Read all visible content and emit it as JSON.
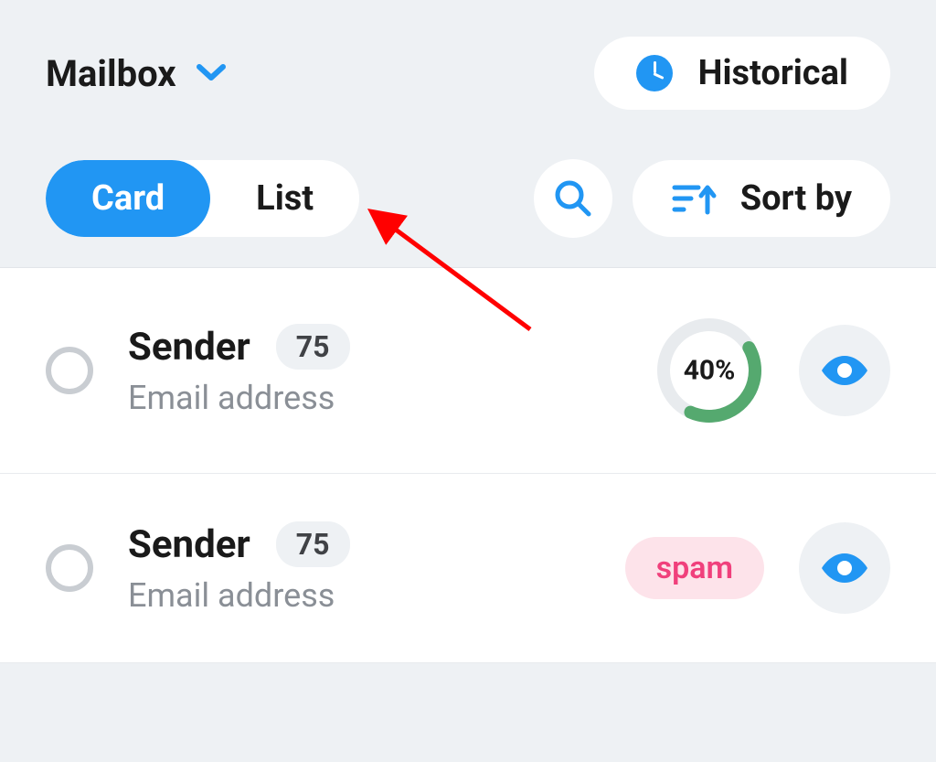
{
  "header": {
    "mailbox_label": "Mailbox",
    "historical_label": "Historical"
  },
  "toolbar": {
    "card_label": "Card",
    "list_label": "List",
    "sort_label": "Sort by"
  },
  "colors": {
    "accent": "#2196f3",
    "progress": "#55a96f",
    "spam_bg": "#fde3ea",
    "spam_text": "#f0407c",
    "annotation": "#ff0000"
  },
  "items": [
    {
      "sender": "Sender",
      "email": "Email address",
      "count": "75",
      "progress_pct": 40,
      "progress_label": "40%",
      "tag": null
    },
    {
      "sender": "Sender",
      "email": "Email address",
      "count": "75",
      "progress_pct": null,
      "progress_label": null,
      "tag": "spam"
    }
  ]
}
